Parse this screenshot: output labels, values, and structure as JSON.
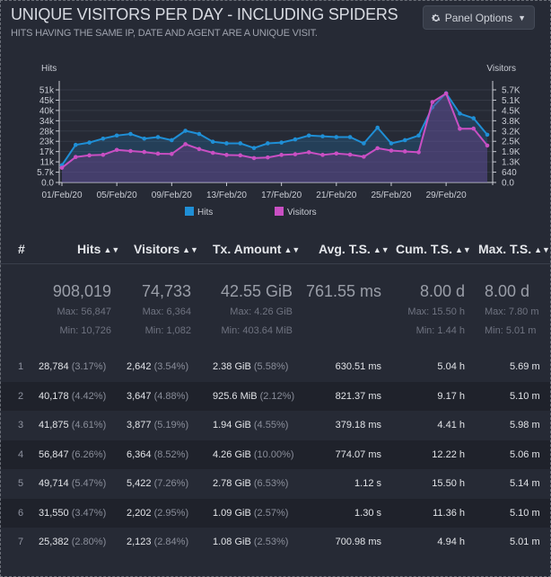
{
  "header": {
    "title": "UNIQUE VISITORS PER DAY - INCLUDING SPIDERS",
    "subtitle": "HITS HAVING THE SAME IP, DATE AND AGENT ARE A UNIQUE VISIT.",
    "panel_options_label": "Panel Options",
    "panel_options_icon": "gear-icon"
  },
  "colors": {
    "hits": "#1f8fd6",
    "visitors": "#c94fc3",
    "background": "#262a35"
  },
  "chart_data": {
    "type": "area",
    "left_axis_label": "Hits",
    "right_axis_label": "Visitors",
    "left_ticks": [
      "51k",
      "45k",
      "40k",
      "34k",
      "28k",
      "23k",
      "17k",
      "11k",
      "5.7k",
      "0.0"
    ],
    "right_ticks": [
      "5.7K",
      "5.1K",
      "4.5K",
      "3.8K",
      "3.2K",
      "2.5K",
      "1.9K",
      "1.3K",
      "640",
      "0.0"
    ],
    "left_ylim": [
      0,
      56847
    ],
    "right_ylim": [
      0,
      6364
    ],
    "x_tick_labels": [
      "01/Feb/20",
      "05/Feb/20",
      "09/Feb/20",
      "13/Feb/20",
      "17/Feb/20",
      "21/Feb/20",
      "25/Feb/20",
      "29/Feb/20"
    ],
    "legend": [
      "Hits",
      "Visitors"
    ],
    "legend_placement": "bottom-center",
    "series": [
      {
        "name": "Hits",
        "values": [
          11000,
          24000,
          25500,
          28000,
          30000,
          31000,
          28000,
          29000,
          27000,
          33000,
          31000,
          26000,
          25000,
          25000,
          22000,
          25000,
          25500,
          27500,
          30000,
          29500,
          29000,
          29000,
          25000,
          35000,
          25000,
          27000,
          30000,
          48000,
          57000,
          44000,
          41000,
          30500
        ]
      },
      {
        "name": "Visitors",
        "values": [
          1050,
          1820,
          1940,
          1980,
          2330,
          2250,
          2180,
          2060,
          2040,
          2740,
          2390,
          2120,
          1970,
          1940,
          1740,
          1790,
          1970,
          2020,
          2160,
          1970,
          2070,
          1990,
          1840,
          2450,
          2280,
          2220,
          2160,
          5750,
          6364,
          3840,
          3850,
          2640
        ]
      }
    ]
  },
  "table": {
    "columns": [
      {
        "label": "#",
        "sortable": false
      },
      {
        "label": "Hits",
        "sortable": true
      },
      {
        "label": "Visitors",
        "sortable": true
      },
      {
        "label": "Tx. Amount",
        "sortable": true
      },
      {
        "label": "Avg. T.S.",
        "sortable": true
      },
      {
        "label": "Cum. T.S.",
        "sortable": true
      },
      {
        "label": "Max. T.S.",
        "sortable": true
      }
    ],
    "summary": {
      "hits": {
        "total": "908,019",
        "max": "Max: 56,847",
        "min": "Min: 10,726"
      },
      "visitors": {
        "total": "74,733",
        "max": "Max: 6,364",
        "min": "Min: 1,082"
      },
      "tx": {
        "total": "42.55 GiB",
        "max": "Max: 4.26 GiB",
        "min": "Min: 403.64 MiB"
      },
      "avg": {
        "total": "761.55 ms"
      },
      "cum": {
        "total": "8.00 d",
        "max": "Max: 15.50 h",
        "min": "Min: 1.44 h"
      },
      "max_ts": {
        "total": "8.00 d",
        "max": "Max: 7.80 m",
        "min": "Min: 5.01 m"
      }
    },
    "rows": [
      {
        "n": "1",
        "hits": "28,784",
        "hits_pct": "(3.17%)",
        "visitors": "2,642",
        "visitors_pct": "(3.54%)",
        "tx": "2.38 GiB",
        "tx_pct": "(5.58%)",
        "avg": "630.51 ms",
        "cum": "5.04 h",
        "max": "5.69 m"
      },
      {
        "n": "2",
        "hits": "40,178",
        "hits_pct": "(4.42%)",
        "visitors": "3,647",
        "visitors_pct": "(4.88%)",
        "tx": "925.6 MiB",
        "tx_pct": "(2.12%)",
        "avg": "821.37 ms",
        "cum": "9.17 h",
        "max": "5.10 m"
      },
      {
        "n": "3",
        "hits": "41,875",
        "hits_pct": "(4.61%)",
        "visitors": "3,877",
        "visitors_pct": "(5.19%)",
        "tx": "1.94 GiB",
        "tx_pct": "(4.55%)",
        "avg": "379.18 ms",
        "cum": "4.41 h",
        "max": "5.98 m"
      },
      {
        "n": "4",
        "hits": "56,847",
        "hits_pct": "(6.26%)",
        "visitors": "6,364",
        "visitors_pct": "(8.52%)",
        "tx": "4.26 GiB",
        "tx_pct": "(10.00%)",
        "avg": "774.07 ms",
        "cum": "12.22 h",
        "max": "5.06 m"
      },
      {
        "n": "5",
        "hits": "49,714",
        "hits_pct": "(5.47%)",
        "visitors": "5,422",
        "visitors_pct": "(7.26%)",
        "tx": "2.78 GiB",
        "tx_pct": "(6.53%)",
        "avg": "1.12 s",
        "cum": "15.50 h",
        "max": "5.14 m"
      },
      {
        "n": "6",
        "hits": "31,550",
        "hits_pct": "(3.47%)",
        "visitors": "2,202",
        "visitors_pct": "(2.95%)",
        "tx": "1.09 GiB",
        "tx_pct": "(2.57%)",
        "avg": "1.30 s",
        "cum": "11.36 h",
        "max": "5.10 m"
      },
      {
        "n": "7",
        "hits": "25,382",
        "hits_pct": "(2.80%)",
        "visitors": "2,123",
        "visitors_pct": "(2.84%)",
        "tx": "1.08 GiB",
        "tx_pct": "(2.53%)",
        "avg": "700.98 ms",
        "cum": "4.94 h",
        "max": "5.01 m"
      }
    ]
  }
}
